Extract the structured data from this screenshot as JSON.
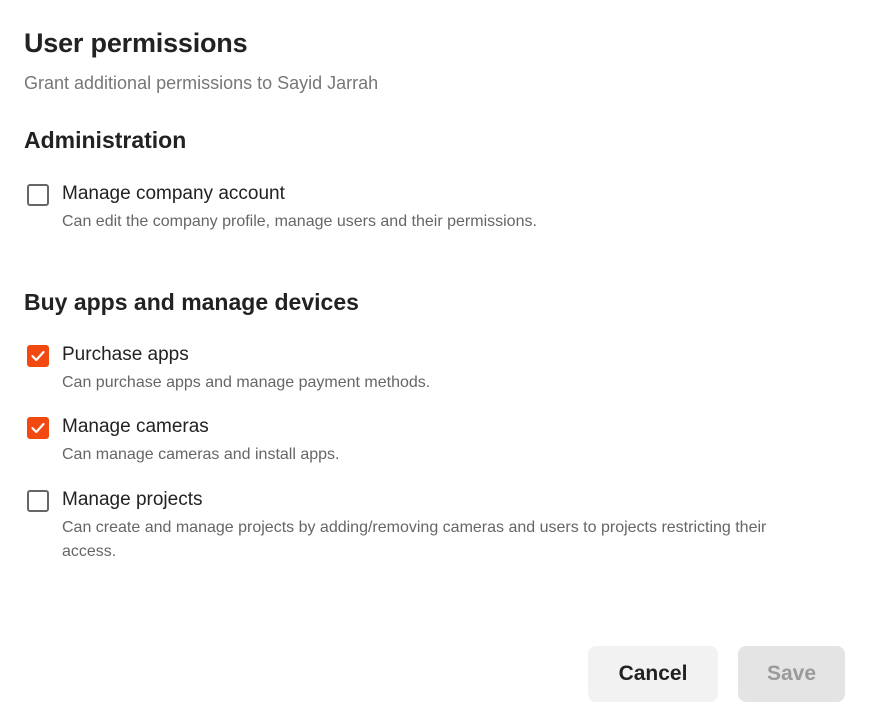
{
  "dialog": {
    "title": "User permissions",
    "subtitle": "Grant additional permissions to Sayid Jarrah"
  },
  "sections": [
    {
      "heading": "Administration",
      "permissions": [
        {
          "label": "Manage company account",
          "description": "Can edit the company profile, manage users and their permissions.",
          "checked": false
        }
      ]
    },
    {
      "heading": "Buy apps and manage devices",
      "permissions": [
        {
          "label": "Purchase apps",
          "description": "Can purchase apps and manage payment methods.",
          "checked": true
        },
        {
          "label": "Manage cameras",
          "description": "Can manage cameras and install apps.",
          "checked": true
        },
        {
          "label": "Manage projects",
          "description": "Can create and manage projects by adding/removing cameras and users to projects restricting their access.",
          "checked": false
        }
      ]
    }
  ],
  "buttons": {
    "cancel_label": "Cancel",
    "save_label": "Save",
    "save_disabled": true
  },
  "colors": {
    "accent": "#f1490f",
    "text": "#222222",
    "muted": "#666666"
  },
  "icons": {
    "checked": "checkmark-icon"
  }
}
